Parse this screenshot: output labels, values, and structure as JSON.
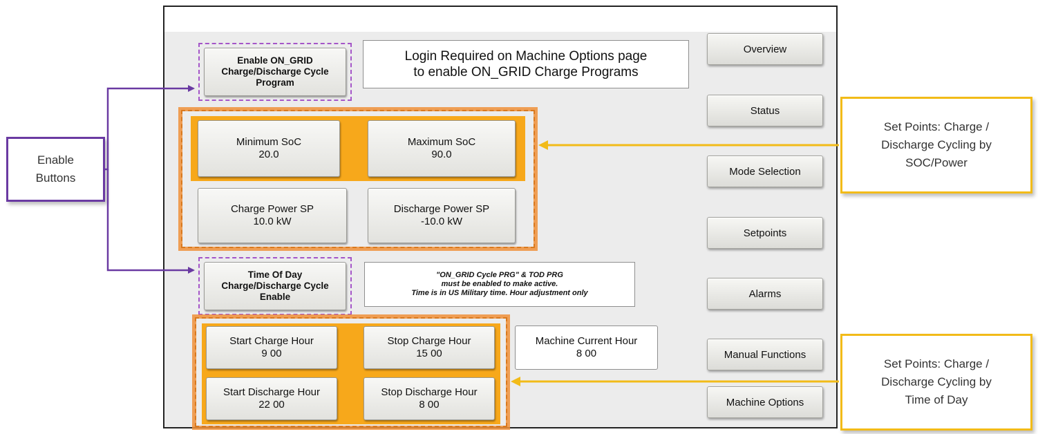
{
  "nav": {
    "items": [
      {
        "label": "Overview"
      },
      {
        "label": "Status"
      },
      {
        "label": "Mode Selection"
      },
      {
        "label": "Setpoints"
      },
      {
        "label": "Alarms"
      },
      {
        "label": "Manual Functions"
      },
      {
        "label": "Machine Options"
      }
    ]
  },
  "enable_on_grid": {
    "line1": "Enable ON_GRID",
    "line2": "Charge/Discharge Cycle",
    "line3": "Program"
  },
  "login_notice": {
    "line1": "Login Required on Machine Options page",
    "line2": "to enable ON_GRID Charge Programs"
  },
  "soc": {
    "min": {
      "label": "Minimum SoC",
      "value": "20.0"
    },
    "max": {
      "label": "Maximum SoC",
      "value": "90.0"
    }
  },
  "power": {
    "charge": {
      "label": "Charge Power SP",
      "value": "10.0 kW"
    },
    "discharge": {
      "label": "Discharge Power SP",
      "value": "-10.0 kW"
    }
  },
  "tod_enable": {
    "line1": "Time Of Day",
    "line2": "Charge/Discharge Cycle",
    "line3": "Enable"
  },
  "tod_note": {
    "line1": "\"ON_GRID Cycle PRG\" & TOD PRG",
    "line2": "must be enabled to make active.",
    "line3": "Time is in US Military time. Hour adjustment only"
  },
  "hours": {
    "start_charge": {
      "label": "Start Charge Hour",
      "value": "9 00"
    },
    "stop_charge": {
      "label": "Stop Charge Hour",
      "value": "15 00"
    },
    "start_discharge": {
      "label": "Start Discharge Hour",
      "value": "22 00"
    },
    "stop_discharge": {
      "label": "Stop Discharge Hour",
      "value": "8 00"
    },
    "machine_current": {
      "label": "Machine Current Hour",
      "value": "8 00"
    }
  },
  "callouts": {
    "enable_buttons": {
      "line1": "Enable",
      "line2": "Buttons"
    },
    "soc_power": {
      "line1": "Set Points: Charge /",
      "line2": "Discharge Cycling by",
      "line3": "SOC/Power"
    },
    "time_of_day": {
      "line1": "Set Points: Charge /",
      "line2": "Discharge Cycling by",
      "line3": "Time of Day"
    }
  },
  "colors": {
    "callout_purple": "#6a3aa2",
    "callout_yellow": "#f2bb18",
    "highlight_orange": "#f7a81b",
    "enable_dash": "#a455c8"
  }
}
